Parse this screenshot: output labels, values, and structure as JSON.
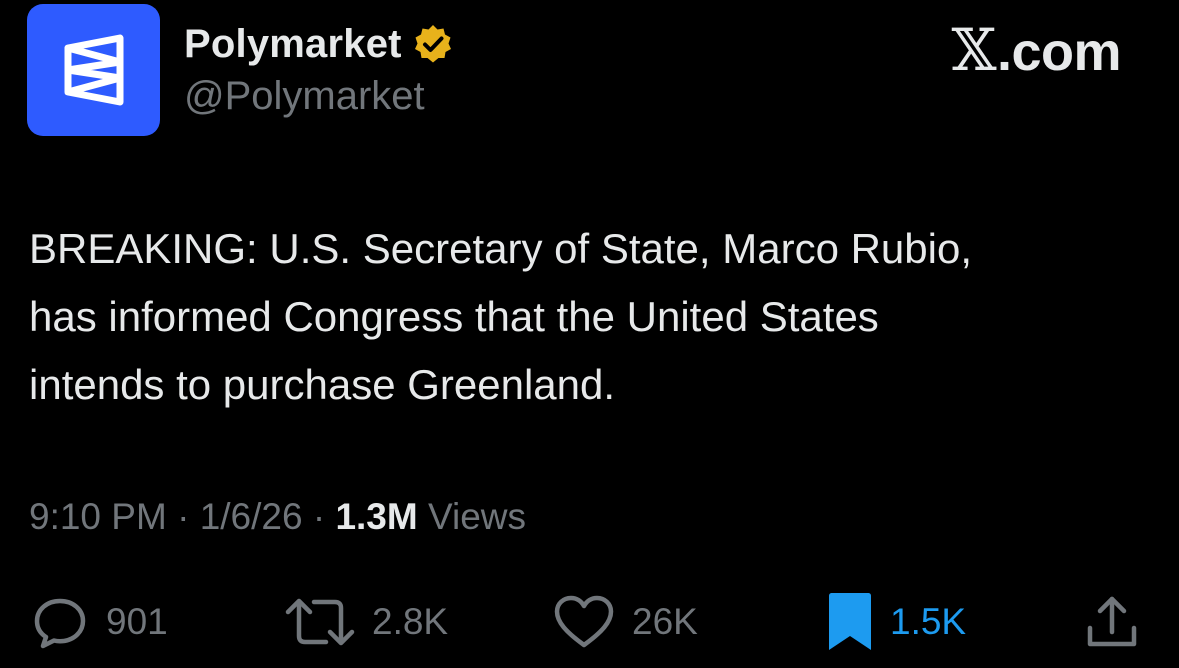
{
  "header": {
    "display_name": "Polymarket",
    "handle": "@Polymarket",
    "brand_text": ".com",
    "brand_x": "𝕏",
    "avatar_color": "#2e5bff",
    "verified_color": "#e8b21b",
    "verified_icon": "verified-badge-icon"
  },
  "tweet": {
    "text_line_1": "BREAKING: U.S. Secretary of State, Marco Rubio,",
    "text_line_2": "has informed Congress that the United States",
    "text_line_3": "intends to purchase Greenland."
  },
  "meta": {
    "time": "9:10 PM",
    "separator": " · ",
    "date": "1/6/26",
    "views_count": "1.3M",
    "views_label": " Views"
  },
  "actions": {
    "replies": {
      "icon": "reply-icon",
      "count": "901"
    },
    "reposts": {
      "icon": "repost-icon",
      "count": "2.8K"
    },
    "likes": {
      "icon": "heart-icon",
      "count": "26K"
    },
    "bookmarks": {
      "icon": "bookmark-icon",
      "count": "1.5K",
      "active": true,
      "color": "#1d9bf0"
    },
    "share": {
      "icon": "share-icon"
    }
  }
}
